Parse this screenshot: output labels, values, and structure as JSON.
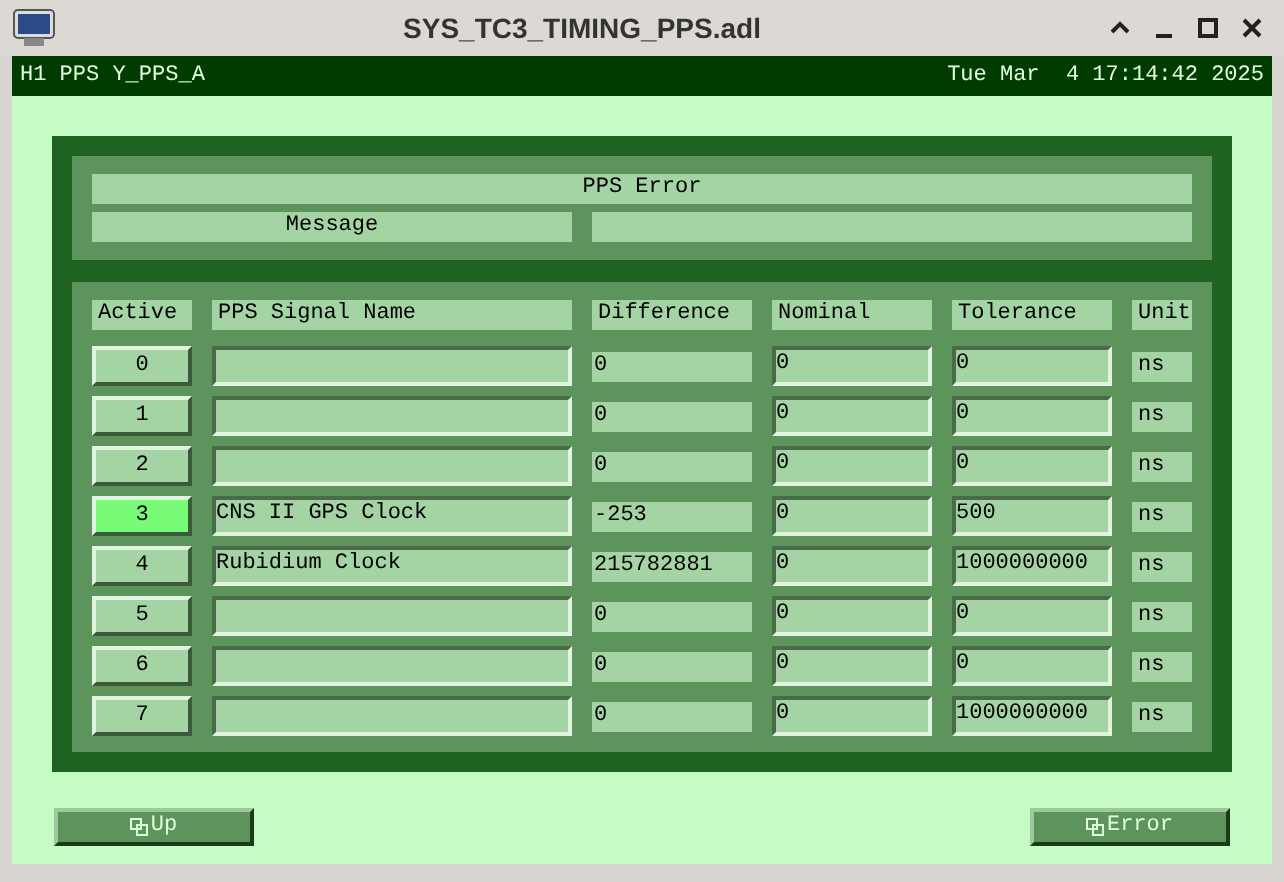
{
  "window": {
    "title": "SYS_TC3_TIMING_PPS.adl"
  },
  "header": {
    "left": "H1 PPS Y_PPS_A",
    "right": "Tue Mar  4 17:14:42 2025"
  },
  "error_panel": {
    "title": "PPS Error",
    "message_label": "Message"
  },
  "table": {
    "columns": [
      "Active",
      "PPS Signal Name",
      "Difference",
      "Nominal",
      "Tolerance",
      "Unit"
    ],
    "rows": [
      {
        "index": "0",
        "active": false,
        "difference": "0",
        "nominal": "0",
        "tolerance": "0",
        "unit": "ns"
      },
      {
        "index": "1",
        "active": false,
        "difference": "0",
        "nominal": "0",
        "tolerance": "0",
        "unit": "ns"
      },
      {
        "index": "2",
        "active": false,
        "difference": "0",
        "nominal": "0",
        "tolerance": "0",
        "unit": "ns"
      },
      {
        "index": "3",
        "active": true,
        "name": "CNS II GPS Clock",
        "difference": "-253",
        "nominal": "0",
        "tolerance": "500",
        "unit": "ns"
      },
      {
        "index": "4",
        "active": false,
        "name": "Rubidium Clock",
        "difference": "215782881",
        "nominal": "0",
        "tolerance": "1000000000",
        "unit": "ns"
      },
      {
        "index": "5",
        "active": false,
        "difference": "0",
        "nominal": "0",
        "tolerance": "0",
        "unit": "ns"
      },
      {
        "index": "6",
        "active": false,
        "difference": "0",
        "nominal": "0",
        "tolerance": "0",
        "unit": "ns"
      },
      {
        "index": "7",
        "active": false,
        "difference": "0",
        "nominal": "0",
        "tolerance": "1000000000",
        "unit": "ns"
      }
    ]
  },
  "buttons": [
    "Up",
    "Error"
  ]
}
